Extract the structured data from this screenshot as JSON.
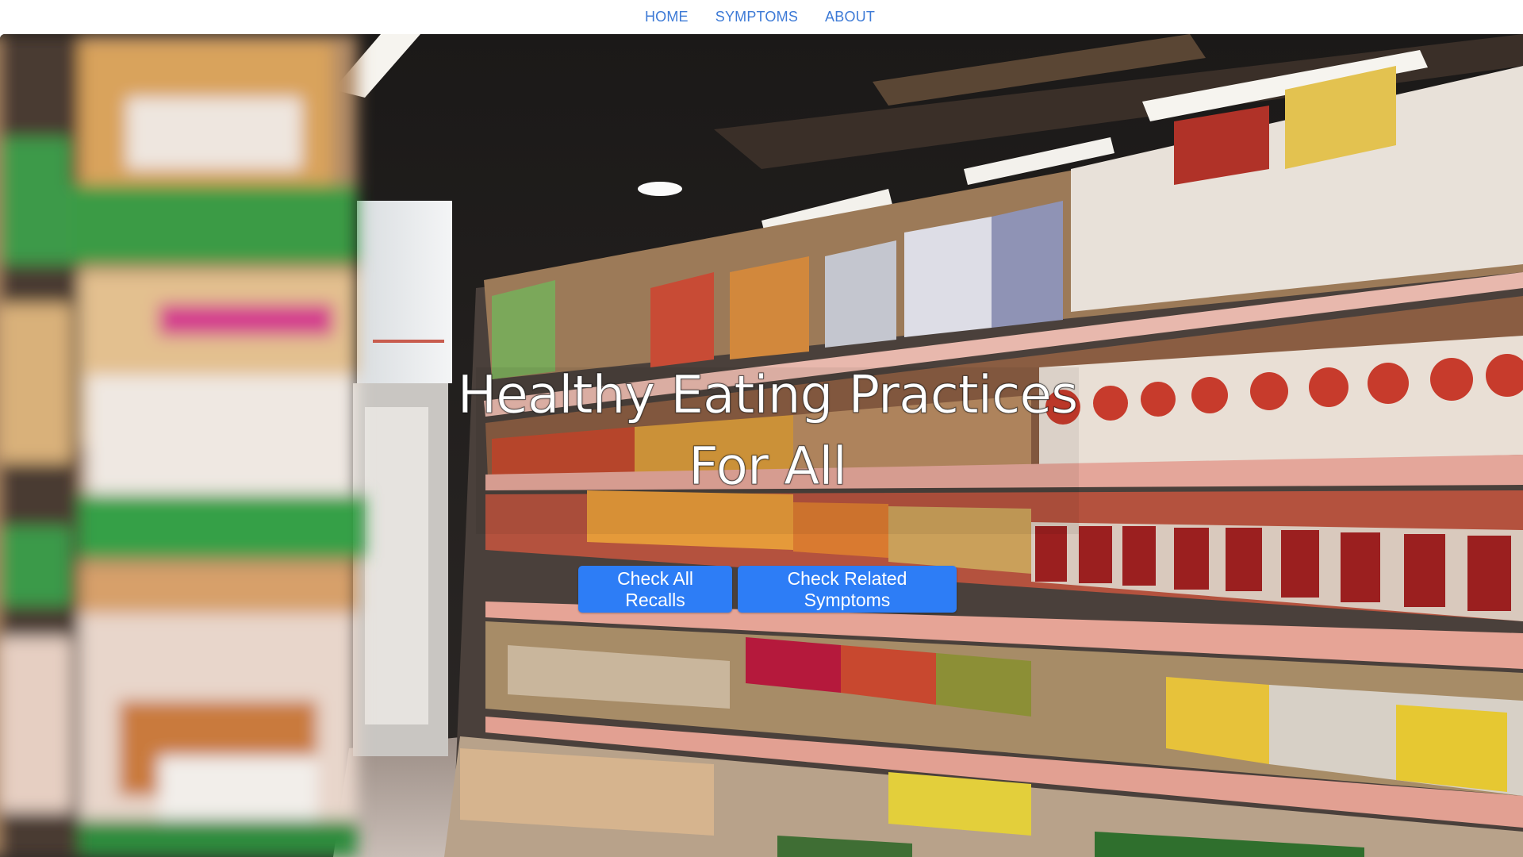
{
  "nav": {
    "items": [
      {
        "label": "HOME"
      },
      {
        "label": "SYMPTOMS"
      },
      {
        "label": "ABOUT"
      }
    ]
  },
  "hero": {
    "title_line1": "Healthy Eating Practices",
    "title_line2": "For All",
    "buttons": {
      "recalls_label": "Check All Recalls",
      "symptoms_label": "Check Related Symptoms"
    }
  },
  "colors": {
    "nav_link": "#3d7ad6",
    "button": "#2d7df6",
    "title_text": "#ffffff"
  }
}
